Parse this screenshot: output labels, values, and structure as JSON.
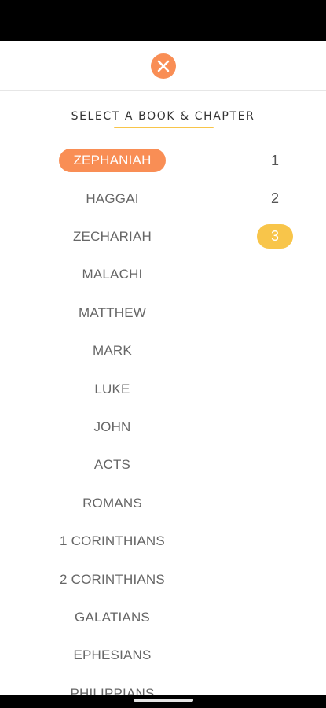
{
  "colors": {
    "accent_orange": "#F98E55",
    "accent_yellow": "#F8C54A"
  },
  "header": {
    "close_icon": "close-icon"
  },
  "picker": {
    "title": "SELECT A BOOK & CHAPTER",
    "books": [
      {
        "label": "ZEPHANIAH",
        "selected": true
      },
      {
        "label": "HAGGAI",
        "selected": false
      },
      {
        "label": "ZECHARIAH",
        "selected": false
      },
      {
        "label": "MALACHI",
        "selected": false
      },
      {
        "label": "MATTHEW",
        "selected": false
      },
      {
        "label": "MARK",
        "selected": false
      },
      {
        "label": "LUKE",
        "selected": false
      },
      {
        "label": "JOHN",
        "selected": false
      },
      {
        "label": "ACTS",
        "selected": false
      },
      {
        "label": "ROMANS",
        "selected": false
      },
      {
        "label": "1 CORINTHIANS",
        "selected": false
      },
      {
        "label": "2 CORINTHIANS",
        "selected": false
      },
      {
        "label": "GALATIANS",
        "selected": false
      },
      {
        "label": "EPHESIANS",
        "selected": false
      },
      {
        "label": "PHILIPPIANS",
        "selected": false
      }
    ],
    "chapters": [
      {
        "label": "1",
        "selected": false
      },
      {
        "label": "2",
        "selected": false
      },
      {
        "label": "3",
        "selected": true
      }
    ]
  }
}
